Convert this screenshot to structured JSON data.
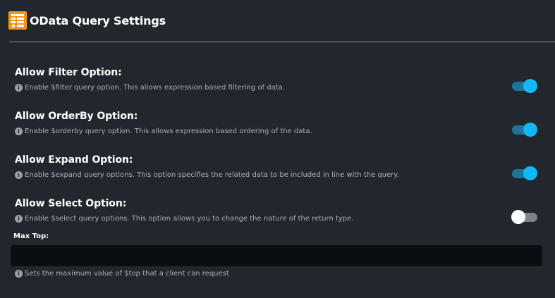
{
  "header": {
    "title": "OData Query Settings",
    "icon": "odata-settings-icon",
    "icon_color": "#f7941d"
  },
  "settings": [
    {
      "title": "Allow Filter Option:",
      "description": "Enable $filter query option. This allows expression based filtering of data.",
      "enabled": true
    },
    {
      "title": "Allow OrderBy Option:",
      "description": "Enable $orderby query option. This allows expression based ordering of the data.",
      "enabled": true
    },
    {
      "title": "Allow Expand Option:",
      "description": "Enable $expand query options. This option specifies the related data to be included in line with the query.",
      "enabled": true
    },
    {
      "title": "Allow Select Option:",
      "description": "Enable $select query options. This option allows you to change the nature of the return type.",
      "enabled": false
    }
  ],
  "max_top": {
    "label": "Max Top:",
    "value": "",
    "help": "Sets the maximum value of $top that a client can request"
  },
  "colors": {
    "background": "#22272e",
    "toggle_on_knob": "#12b7f5",
    "toggle_on_track": "#1f7399",
    "toggle_off_track": "#7d8187"
  }
}
